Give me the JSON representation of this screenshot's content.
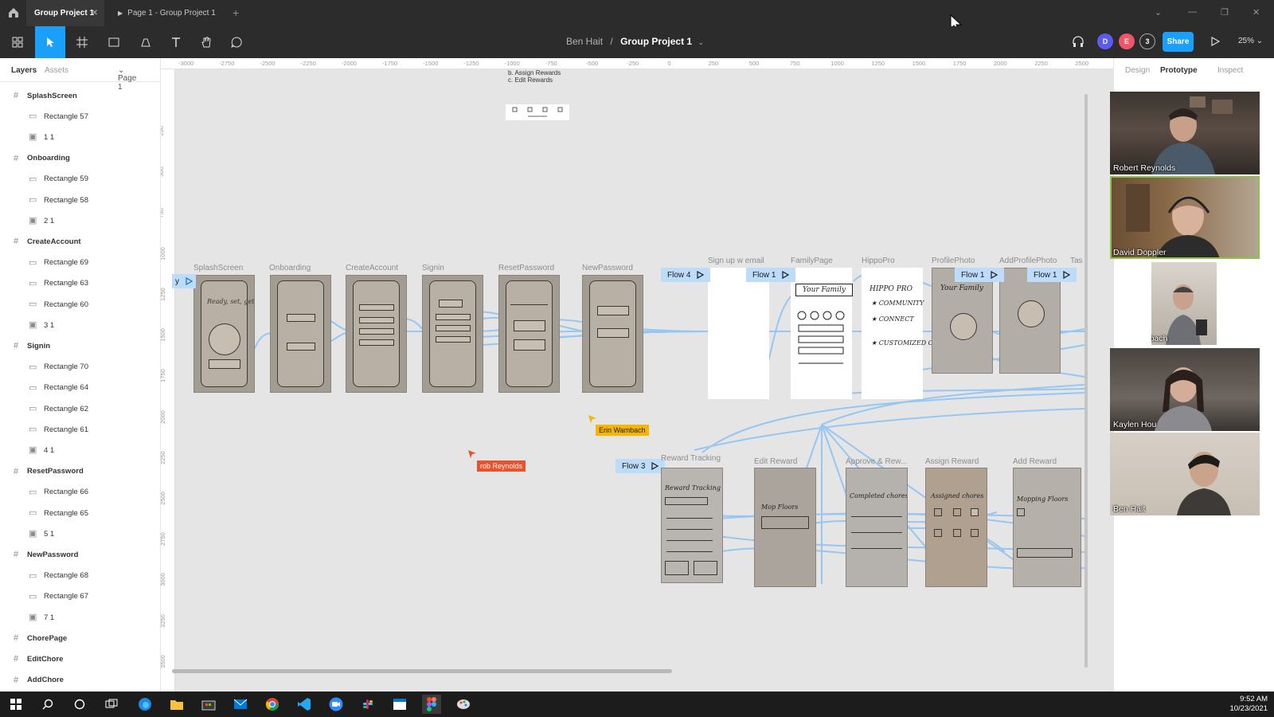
{
  "titlebar": {
    "active_tab": "Group Project 1",
    "inactive_tab": "Page 1 - Group Project 1"
  },
  "toolbar": {
    "team": "Ben Hait",
    "separator": "/",
    "file": "Group Project 1",
    "avatars": [
      {
        "initial": "D",
        "color": "#5b5bf0"
      },
      {
        "initial": "E",
        "color": "#f0566b"
      },
      {
        "initial": "3",
        "color": "#2c2c2c"
      }
    ],
    "share_label": "Share",
    "zoom": "25%"
  },
  "left_panel": {
    "tab_layers": "Layers",
    "tab_assets": "Assets",
    "page_select": "Page 1",
    "layers": [
      {
        "type": "frame",
        "label": "SplashScreen"
      },
      {
        "type": "rect",
        "label": "Rectangle 57"
      },
      {
        "type": "image",
        "label": "1 1"
      },
      {
        "type": "frame",
        "label": "Onboarding"
      },
      {
        "type": "rect",
        "label": "Rectangle 59"
      },
      {
        "type": "rect",
        "label": "Rectangle 58"
      },
      {
        "type": "image",
        "label": "2 1"
      },
      {
        "type": "frame",
        "label": "CreateAccount"
      },
      {
        "type": "rect",
        "label": "Rectangle 69"
      },
      {
        "type": "rect",
        "label": "Rectangle 63"
      },
      {
        "type": "rect",
        "label": "Rectangle 60"
      },
      {
        "type": "image",
        "label": "3 1"
      },
      {
        "type": "frame",
        "label": "Signin"
      },
      {
        "type": "rect",
        "label": "Rectangle 70"
      },
      {
        "type": "rect",
        "label": "Rectangle 64"
      },
      {
        "type": "rect",
        "label": "Rectangle 62"
      },
      {
        "type": "rect",
        "label": "Rectangle 61"
      },
      {
        "type": "image",
        "label": "4 1"
      },
      {
        "type": "frame",
        "label": "ResetPassword"
      },
      {
        "type": "rect",
        "label": "Rectangle 66"
      },
      {
        "type": "rect",
        "label": "Rectangle 65"
      },
      {
        "type": "image",
        "label": "5 1"
      },
      {
        "type": "frame",
        "label": "NewPassword"
      },
      {
        "type": "rect",
        "label": "Rectangle 68"
      },
      {
        "type": "rect",
        "label": "Rectangle 67"
      },
      {
        "type": "image",
        "label": "7 1"
      },
      {
        "type": "frame",
        "label": "ChorePage"
      },
      {
        "type": "frame",
        "label": "EditChore"
      },
      {
        "type": "frame",
        "label": "AddChore"
      }
    ]
  },
  "canvas": {
    "ruler_top": [
      "-3000",
      "-2750",
      "-2500",
      "-2250",
      "-2000",
      "-1750",
      "-1500",
      "-1250",
      "-1000",
      "-750",
      "-500",
      "-250",
      "0",
      "250",
      "500",
      "750",
      "1000",
      "1250",
      "1500",
      "1750",
      "2000",
      "2250",
      "2500"
    ],
    "ruler_left": [
      "0",
      "250",
      "500",
      "750",
      "1000",
      "1250",
      "1500",
      "1750",
      "2000",
      "2250",
      "2500",
      "2750",
      "3000",
      "3250",
      "3500"
    ],
    "note_lines": [
      "b. Assign Rewards",
      "c. Edit Rewards"
    ],
    "frame_labels_row1": [
      "SplashScreen",
      "Onboarding",
      "CreateAccount",
      "Signin",
      "ResetPassword",
      "NewPassword",
      "Sign up w email",
      "FamilyPage",
      "HippoPro",
      "ProfilePhoto",
      "AddProfilePhoto",
      "Tas"
    ],
    "frame_labels_row2": [
      "Reward Tracking",
      "Edit Reward",
      "Approve & Rew...",
      "Assign Reward",
      "Add Reward"
    ],
    "flow_tags": [
      "y",
      "Flow 4",
      "Flow 1",
      "Flow 1",
      "Flow 1",
      "Flow 3"
    ],
    "cursors": [
      {
        "name": "Erin Wambach",
        "color": "#f7b500",
        "text_color": "#222"
      },
      {
        "name": "rob Reynolds",
        "color": "#e8532e",
        "text_color": "#fff"
      }
    ],
    "sketch_texts": {
      "splash": "Ready, set, get!",
      "family": "Your Family",
      "hippo": "HIPPO PRO",
      "hippo_items": [
        "COMMUNITY",
        "CONNECT",
        "CUSTOMIZED COLOR"
      ],
      "profile": "Your Family",
      "reward_tracking": "Reward Tracking",
      "edit_reward": "Mop Floors",
      "approve": "Completed chores",
      "assign": "Assigned chores",
      "add_reward": "Mopping Floors"
    },
    "help": "?"
  },
  "right_panel": {
    "tabs": [
      "Design",
      "Prototype",
      "Inspect"
    ],
    "active_tab": "Prototype"
  },
  "video_call": {
    "participants": [
      "Robert Reynolds",
      "David Doppler",
      "Erin Wambach",
      "Kaylen Hou",
      "Ben Hait"
    ],
    "active_speaker": "David Doppler"
  },
  "taskbar": {
    "time": "9:52 AM",
    "date": "10/23/2021"
  }
}
